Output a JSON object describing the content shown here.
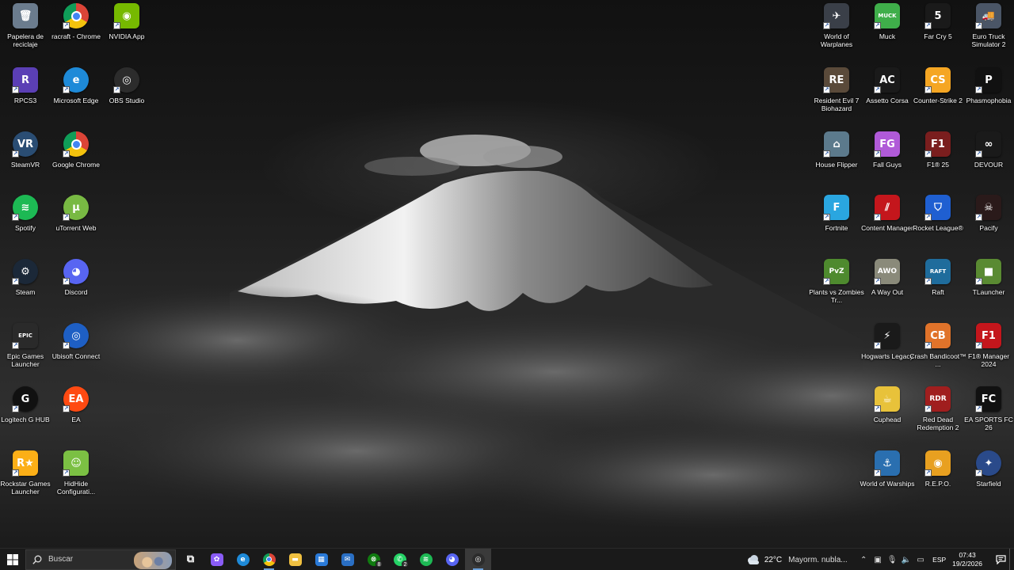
{
  "desktop": {
    "left_icons": [
      {
        "label": "Papelera de reciclaje",
        "icon": "recycle-bin-icon",
        "color": "#6b7c8e",
        "glyph": "🗑",
        "shortcut": false
      },
      {
        "label": "racraft - Chrome",
        "icon": "chrome-icon",
        "color": "#db4437",
        "glyph": "",
        "shortcut": true
      },
      {
        "label": "NVIDIA App",
        "icon": "nvidia-icon",
        "color": "#76b900",
        "glyph": "◉",
        "shortcut": true
      },
      {
        "label": "RPCS3",
        "icon": "rpcs3-icon",
        "color": "#5b3fb5",
        "glyph": "R",
        "shortcut": true
      },
      {
        "label": "Microsoft Edge",
        "icon": "edge-icon",
        "color": "#1e8ad8",
        "glyph": "e",
        "shortcut": true
      },
      {
        "label": "OBS Studio",
        "icon": "obs-icon",
        "color": "#2c2c2c",
        "glyph": "◎",
        "shortcut": true
      },
      {
        "label": "SteamVR",
        "icon": "steamvr-icon",
        "color": "#2a4d73",
        "glyph": "VR",
        "shortcut": true
      },
      {
        "label": "Google Chrome",
        "icon": "chrome-icon",
        "color": "#db4437",
        "glyph": "",
        "shortcut": true
      },
      {
        "label": "Spotify",
        "icon": "spotify-icon",
        "color": "#1db954",
        "glyph": "≋",
        "shortcut": true
      },
      {
        "label": "uTorrent Web",
        "icon": "utorrent-icon",
        "color": "#78b943",
        "glyph": "μ",
        "shortcut": true
      },
      {
        "label": "Steam",
        "icon": "steam-icon",
        "color": "#1b2838",
        "glyph": "⚙",
        "shortcut": true
      },
      {
        "label": "Discord",
        "icon": "discord-icon",
        "color": "#5865f2",
        "glyph": "◕",
        "shortcut": true
      },
      {
        "label": "Epic Games Launcher",
        "icon": "epic-games-icon",
        "color": "#2a2a2a",
        "glyph": "EPIC",
        "shortcut": true
      },
      {
        "label": "Ubisoft Connect",
        "icon": "ubisoft-icon",
        "color": "#1e5fc4",
        "glyph": "◎",
        "shortcut": true
      },
      {
        "label": "Logitech G HUB",
        "icon": "logitech-icon",
        "color": "#111111",
        "glyph": "G",
        "shortcut": true
      },
      {
        "label": "EA",
        "icon": "ea-icon",
        "color": "#ff4a12",
        "glyph": "EA",
        "shortcut": true
      },
      {
        "label": "Rockstar Games Launcher",
        "icon": "rockstar-icon",
        "color": "#fcaf17",
        "glyph": "R★",
        "shortcut": true
      },
      {
        "label": "HidHide Configurati...",
        "icon": "hidhide-icon",
        "color": "#7bc043",
        "glyph": "☺",
        "shortcut": true
      }
    ],
    "right_icons": [
      {
        "label": "World of Warplanes",
        "icon": "world-of-warplanes-icon",
        "color": "#3a3f48",
        "glyph": "✈",
        "shortcut": true
      },
      {
        "label": "Muck",
        "icon": "muck-icon",
        "color": "#3fae4a",
        "glyph": "MUCK",
        "shortcut": true
      },
      {
        "label": "Far Cry 5",
        "icon": "far-cry-5-icon",
        "color": "#1a1a1a",
        "glyph": "5",
        "shortcut": true
      },
      {
        "label": "Euro Truck Simulator 2",
        "icon": "ets2-icon",
        "color": "#4a5566",
        "glyph": "🚚",
        "shortcut": true
      },
      {
        "label": "Resident Evil 7 Biohazard",
        "icon": "resident-evil-7-icon",
        "color": "#5a4a3a",
        "glyph": "RE",
        "shortcut": true
      },
      {
        "label": "Assetto Corsa",
        "icon": "assetto-corsa-icon",
        "color": "#1a1a1a",
        "glyph": "AC",
        "shortcut": true
      },
      {
        "label": "Counter-Strike 2",
        "icon": "counter-strike-2-icon",
        "color": "#f5a623",
        "glyph": "CS",
        "shortcut": true
      },
      {
        "label": "Phasmophobia",
        "icon": "phasmophobia-icon",
        "color": "#111111",
        "glyph": "P",
        "shortcut": true
      },
      {
        "label": "House Flipper",
        "icon": "house-flipper-icon",
        "color": "#5c7a8c",
        "glyph": "⌂",
        "shortcut": true
      },
      {
        "label": "Fall Guys",
        "icon": "fall-guys-icon",
        "color": "#b05ad8",
        "glyph": "FG",
        "shortcut": true
      },
      {
        "label": "F1® 25",
        "icon": "f1-25-icon",
        "color": "#7a1e1e",
        "glyph": "F1",
        "shortcut": true
      },
      {
        "label": "DEVOUR",
        "icon": "devour-icon",
        "color": "#1a1a1a",
        "glyph": "∞",
        "shortcut": true
      },
      {
        "label": "Fortnite",
        "icon": "fortnite-icon",
        "color": "#2aa6e0",
        "glyph": "F",
        "shortcut": true
      },
      {
        "label": "Content Manager",
        "icon": "content-manager-icon",
        "color": "#c4161c",
        "glyph": "⫽",
        "shortcut": true
      },
      {
        "label": "Rocket League®",
        "icon": "rocket-league-icon",
        "color": "#1f5fd1",
        "glyph": "⛉",
        "shortcut": true
      },
      {
        "label": "Pacify",
        "icon": "pacify-icon",
        "color": "#2a1a1a",
        "glyph": "☠",
        "shortcut": true
      },
      {
        "label": "Plants vs Zombies Tr...",
        "icon": "plants-vs-zombies-icon",
        "color": "#4e8a2e",
        "glyph": "PvZ",
        "shortcut": true
      },
      {
        "label": "A Way Out",
        "icon": "a-way-out-icon",
        "color": "#8a8a7a",
        "glyph": "AWO",
        "shortcut": true
      },
      {
        "label": "Raft",
        "icon": "raft-icon",
        "color": "#1f6c9c",
        "glyph": "RAFT",
        "shortcut": true
      },
      {
        "label": "TLauncher",
        "icon": "tlauncher-icon",
        "color": "#5a8a32",
        "glyph": "■",
        "shortcut": true
      },
      {
        "label": "Hogwarts Legacy",
        "icon": "hogwarts-legacy-icon",
        "color": "#1a1a1a",
        "glyph": "⚡",
        "shortcut": true
      },
      {
        "label": "Crash Bandicoot™ ...",
        "icon": "crash-bandicoot-icon",
        "color": "#e0732a",
        "glyph": "CB",
        "shortcut": true
      },
      {
        "label": "F1® Manager 2024",
        "icon": "f1-manager-2024-icon",
        "color": "#c4161c",
        "glyph": "F1",
        "shortcut": true
      },
      {
        "label": "Cuphead",
        "icon": "cuphead-icon",
        "color": "#e8c23a",
        "glyph": "☕",
        "shortcut": true
      },
      {
        "label": "Red Dead Redemption 2",
        "icon": "red-dead-redemption-2-icon",
        "color": "#a01e1e",
        "glyph": "RDR",
        "shortcut": true
      },
      {
        "label": "EA SPORTS FC 26",
        "icon": "ea-sports-fc-26-icon",
        "color": "#111111",
        "glyph": "FC",
        "shortcut": true
      },
      {
        "label": "World of Warships",
        "icon": "world-of-warships-icon",
        "color": "#2a6fb0",
        "glyph": "⚓",
        "shortcut": true
      },
      {
        "label": "R.E.P.O.",
        "icon": "repo-icon",
        "color": "#e8a020",
        "glyph": "◉",
        "shortcut": true
      },
      {
        "label": "Starfield",
        "icon": "starfield-icon",
        "color": "#2a4a8a",
        "glyph": "✦",
        "shortcut": true
      }
    ]
  },
  "taskbar": {
    "search_placeholder": "Buscar",
    "apps": [
      {
        "name": "task-view-icon",
        "glyph": "⧉",
        "color": "#1a1a1a",
        "open": false,
        "badge": ""
      },
      {
        "name": "copilot-icon",
        "glyph": "✿",
        "color": "#8a5cf6",
        "open": false,
        "badge": ""
      },
      {
        "name": "edge-icon",
        "glyph": "e",
        "color": "#1e8ad8",
        "open": false,
        "badge": ""
      },
      {
        "name": "chrome-icon",
        "glyph": "",
        "color": "#db4437",
        "open": true,
        "badge": ""
      },
      {
        "name": "file-explorer-icon",
        "glyph": "▬",
        "color": "#f0c040",
        "open": false,
        "badge": ""
      },
      {
        "name": "microsoft-store-icon",
        "glyph": "▦",
        "color": "#2a7ad8",
        "open": false,
        "badge": ""
      },
      {
        "name": "mail-icon",
        "glyph": "✉",
        "color": "#2a6fc4",
        "open": false,
        "badge": ""
      },
      {
        "name": "xbox-icon",
        "glyph": "⊗",
        "color": "#107c10",
        "open": false,
        "badge": "8"
      },
      {
        "name": "whatsapp-icon",
        "glyph": "✆",
        "color": "#25d366",
        "open": false,
        "badge": "2"
      },
      {
        "name": "spotify-icon",
        "glyph": "≋",
        "color": "#1db954",
        "open": false,
        "badge": ""
      },
      {
        "name": "discord-icon",
        "glyph": "◕",
        "color": "#5865f2",
        "open": false,
        "badge": ""
      },
      {
        "name": "obs-icon",
        "glyph": "◎",
        "color": "#2c2c2c",
        "open": true,
        "badge": ""
      }
    ],
    "weather": {
      "temp": "22°C",
      "desc": "Mayorm. nubla..."
    },
    "tray_icons": [
      "chevron-up-icon",
      "camera-icon",
      "microphone-icon",
      "volume-icon",
      "network-icon"
    ],
    "language": "ESP",
    "time": "07:43",
    "date": "19/2/2026"
  }
}
